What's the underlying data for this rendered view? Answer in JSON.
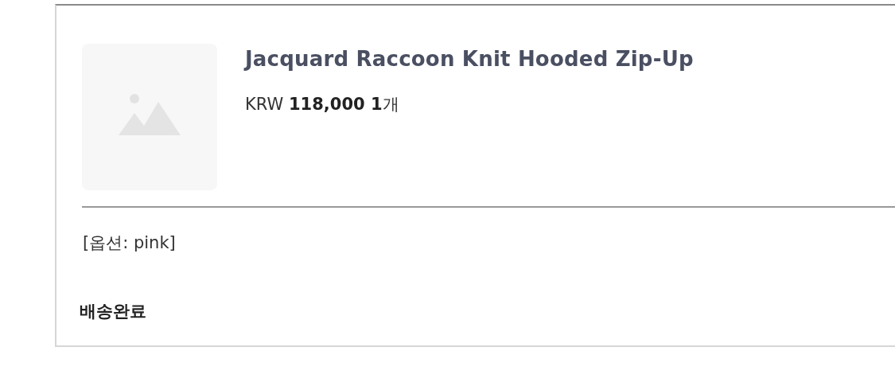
{
  "order_item": {
    "product_name": "Jacquard Raccoon Knit Hooded Zip-Up",
    "price_line": "KRW **118,000 1**개",
    "option": "[옵션: pink]",
    "status": "배송완료"
  }
}
